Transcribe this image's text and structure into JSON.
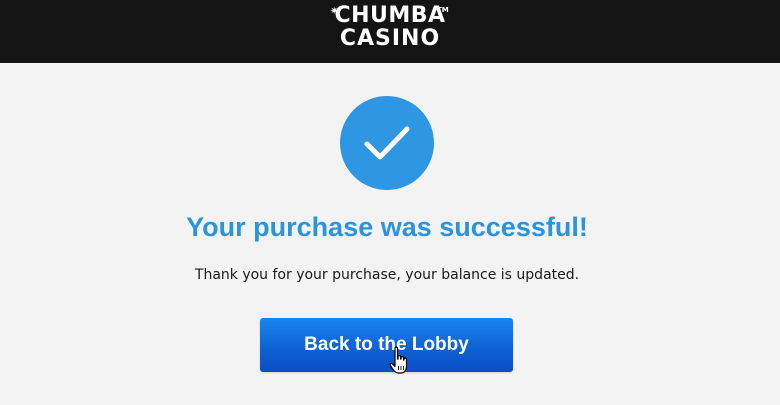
{
  "header": {
    "logo_line1": "CHUMBA",
    "logo_line2": "CASINO",
    "logo_star": "✷",
    "logo_tm": "TM"
  },
  "main": {
    "title": "Your purchase was successful!",
    "message": "Thank you for your purchase, your balance is updated.",
    "button_label": "Back to the Lobby"
  },
  "icons": {
    "success": "checkmark-icon",
    "cursor": "hand-pointer-icon"
  },
  "colors": {
    "header_bg": "#141414",
    "page_bg": "#f3f3f3",
    "accent": "#2e96e2",
    "title": "#2b94dd",
    "button": "#1068d8",
    "text": "#1a1a1a"
  }
}
